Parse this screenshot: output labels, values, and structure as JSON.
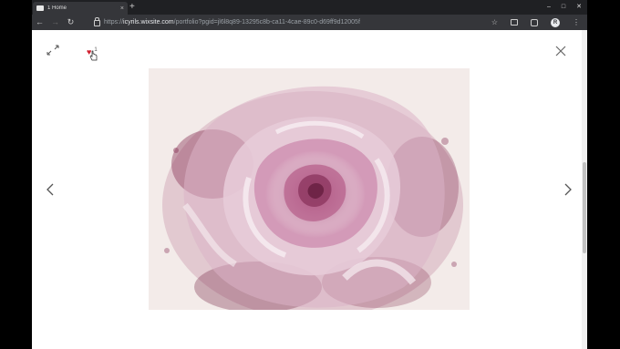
{
  "browser": {
    "tab": {
      "title": "1 Home",
      "close_label": "×"
    },
    "new_tab_label": "+",
    "window_controls": {
      "minimize": "–",
      "maximize": "□",
      "close": "✕"
    },
    "nav": {
      "back": "←",
      "forward": "→",
      "reload": "↻"
    },
    "address": {
      "scheme": "https://",
      "host": "icyrils.wixsite.com",
      "path": "/portfolio?pgid=jl6l8q89-13295c8b-ca11-4cae-89c0-d69ff9d12005f"
    },
    "bookmark_icon": "star-icon",
    "profile_initial": "R",
    "menu_icon": "⋮"
  },
  "lightbox": {
    "likes_count": "1",
    "icons": [
      "expand-icon",
      "heart-icon",
      "close-icon",
      "chevron-left-icon",
      "chevron-right-icon"
    ],
    "image_subject": "watercolor pink rose"
  },
  "colors": {
    "chrome_bg": "#1f2023",
    "toolbar_bg": "#35363a",
    "page_bg": "#ffffff",
    "heart": "#d11f2e",
    "rose_pink": "#c47fa3",
    "rose_dark": "#7a2d4d"
  }
}
